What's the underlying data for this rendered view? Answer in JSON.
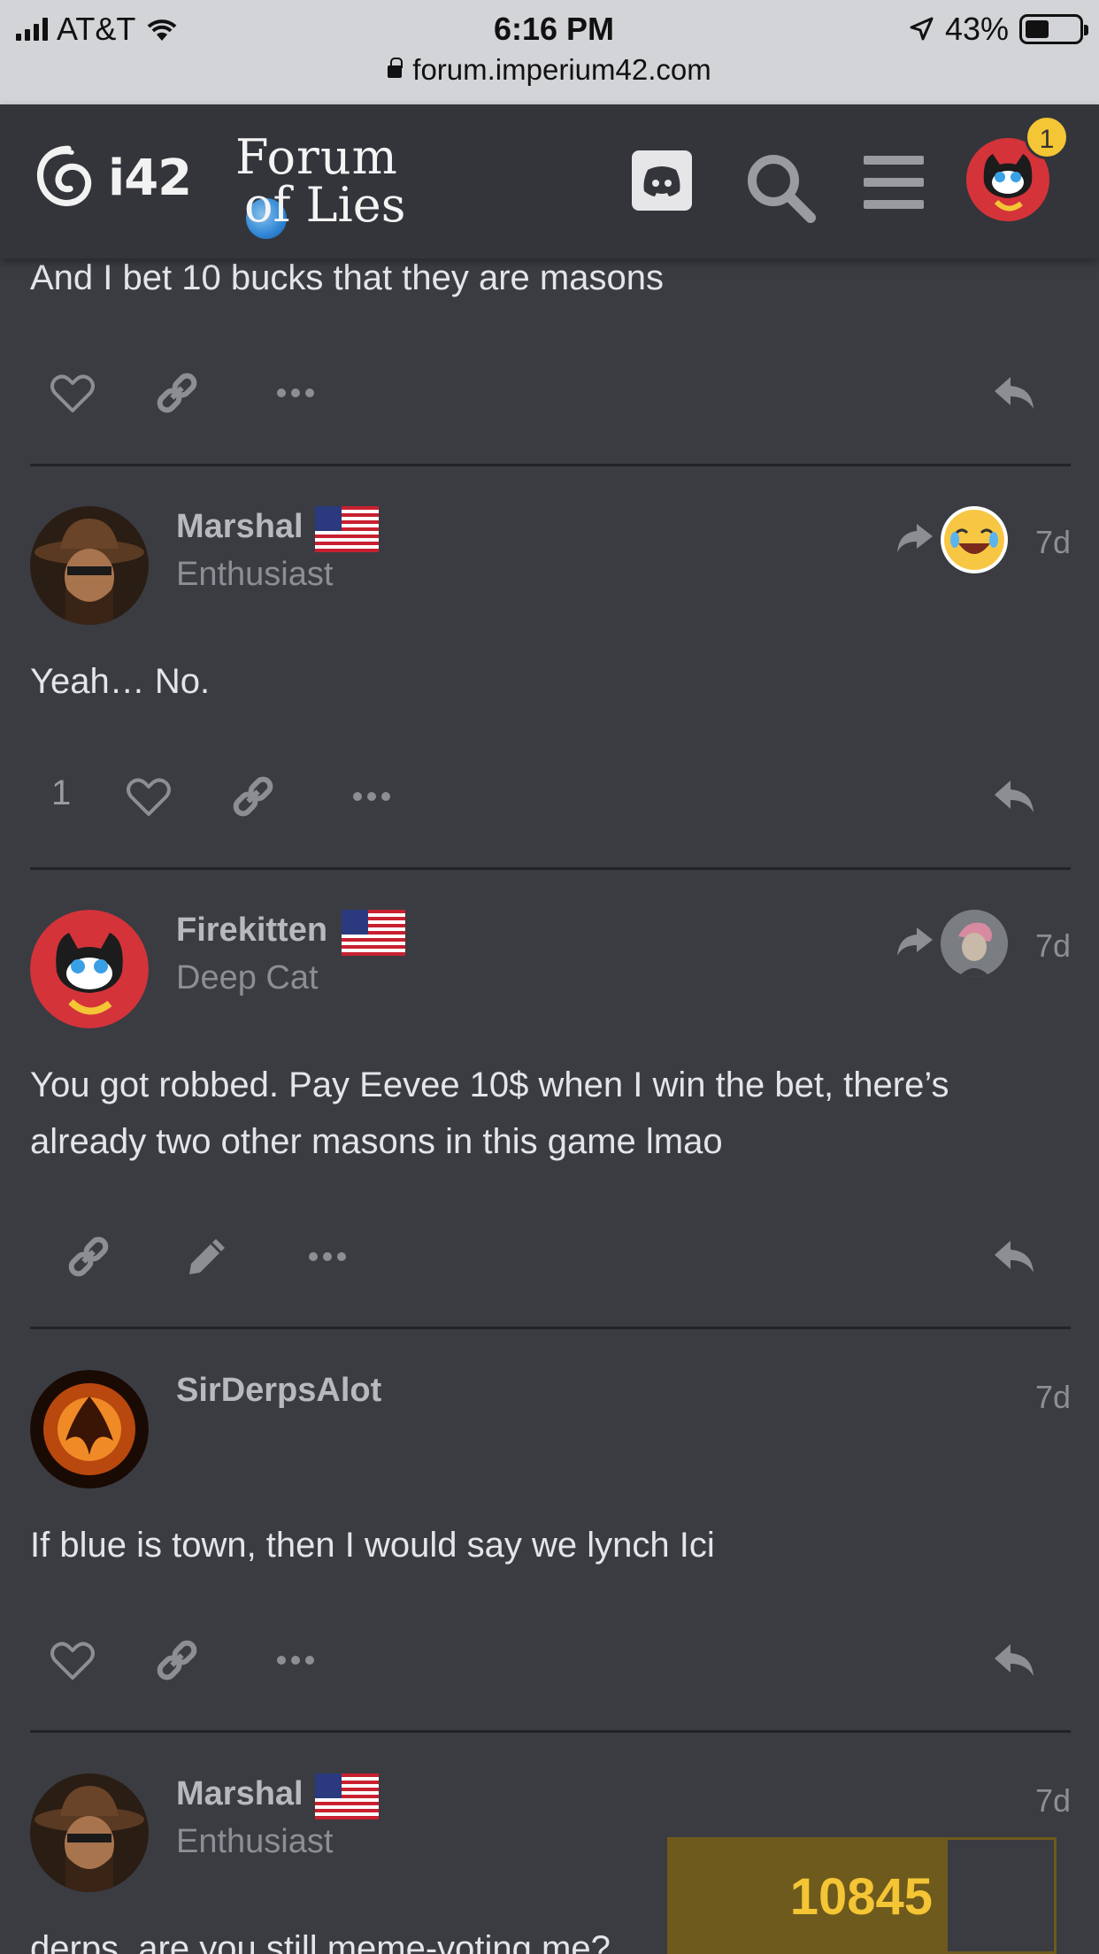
{
  "status_bar": {
    "carrier": "AT&T",
    "time": "6:16 PM",
    "battery": "43%",
    "url": "forum.imperium42.com"
  },
  "header": {
    "logo_text": "i42",
    "forum_logo_line1": "Forum",
    "forum_logo_line2": "of Lies",
    "notification_count": "1"
  },
  "posts": [
    {
      "text": "And I bet 10 bucks that they are masons",
      "like_count": ""
    },
    {
      "username": "Marshal",
      "title": "Enthusiast",
      "age": "7d",
      "text": "Yeah… No.",
      "like_count": "1"
    },
    {
      "username": "Firekitten",
      "title": "Deep Cat",
      "age": "7d",
      "text_line1": "You got robbed. Pay Eevee 10$ when I win the bet, there’s",
      "text_line2": "already two other masons in this game lmao"
    },
    {
      "username": "SirDerpsAlot",
      "title": "",
      "age": "7d",
      "text": "If blue is town, then I would say we lynch Ici"
    },
    {
      "username": "Marshal",
      "title": "Enthusiast",
      "age": "7d",
      "text": "derps, are you still meme-voting me?"
    }
  ],
  "overlay": {
    "counter_value": "10845"
  },
  "colors": {
    "background": "#3a3c42",
    "header": "#33353a",
    "badge": "#f4c534",
    "counter_bg": "#6e5a1c"
  }
}
